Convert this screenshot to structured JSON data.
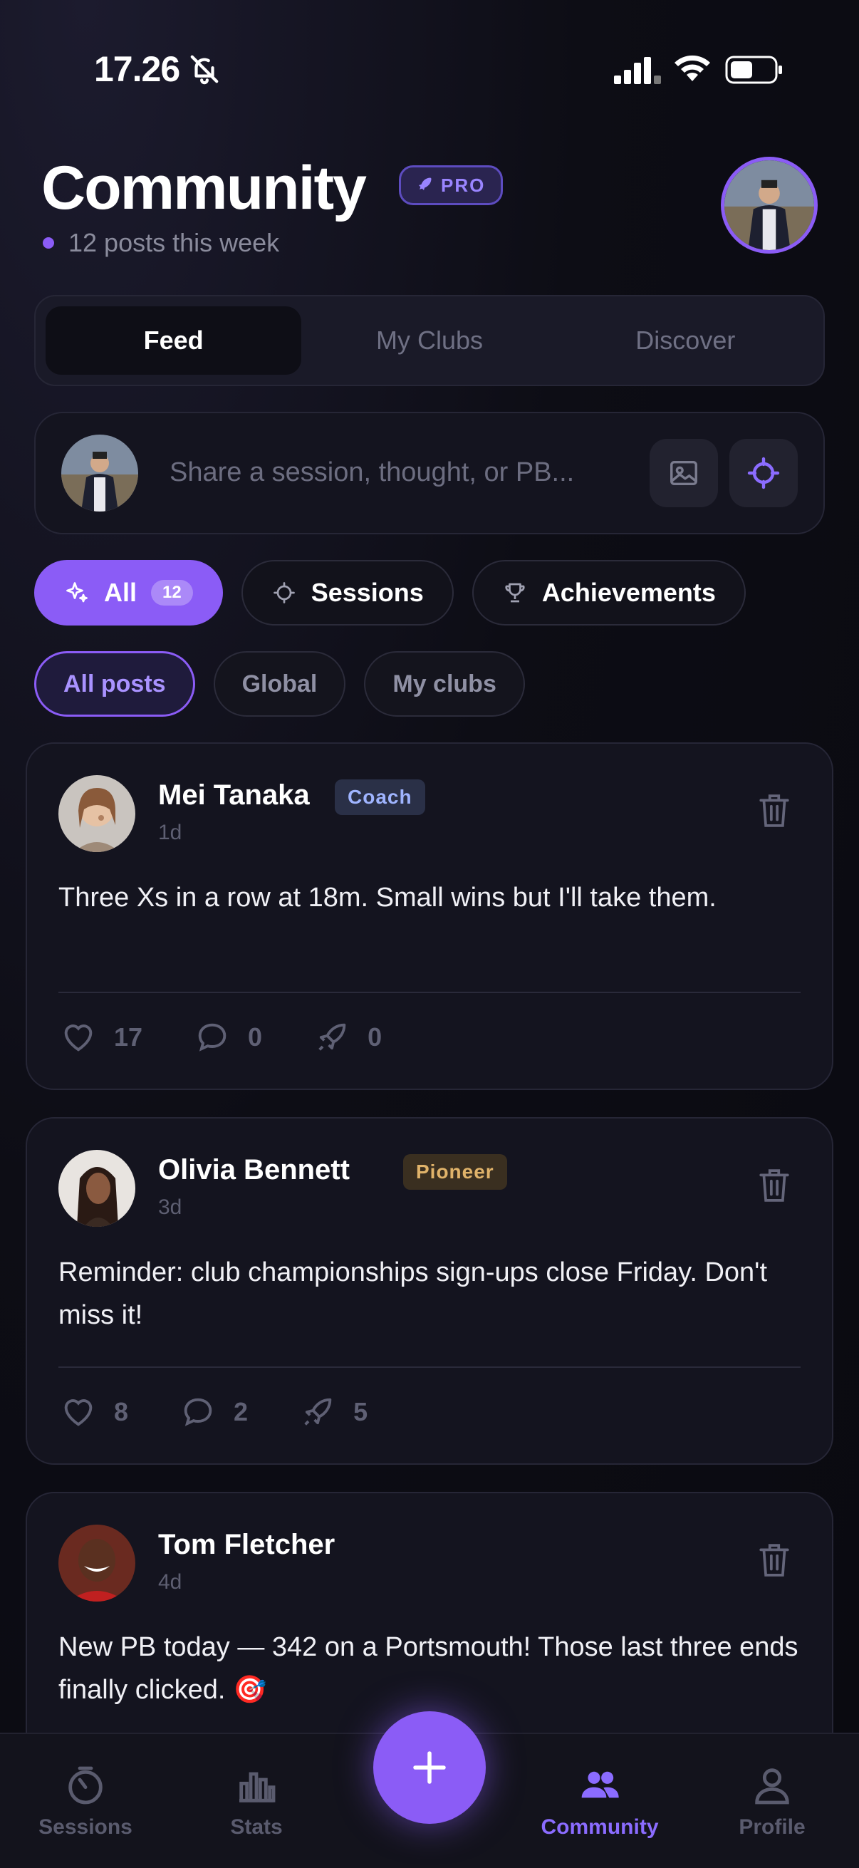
{
  "status_bar": {
    "time": "17.26"
  },
  "header": {
    "title": "Community",
    "badge": "PRO",
    "subtitle": "12 posts this week"
  },
  "segments": [
    {
      "label": "Feed",
      "active": true
    },
    {
      "label": "My Clubs",
      "active": false
    },
    {
      "label": "Discover",
      "active": false
    }
  ],
  "composer": {
    "placeholder": "Share a session, thought, or PB..."
  },
  "filters": [
    {
      "label": "All",
      "count": "12",
      "icon": "sparkles-icon",
      "active": true
    },
    {
      "label": "Sessions",
      "icon": "crosshair-icon",
      "active": false
    },
    {
      "label": "Achievements",
      "icon": "trophy-icon",
      "active": false
    }
  ],
  "scope": [
    {
      "label": "All posts",
      "active": true
    },
    {
      "label": "Global",
      "active": false
    },
    {
      "label": "My clubs",
      "active": false
    }
  ],
  "posts": [
    {
      "name": "Mei Tanaka",
      "role": "Coach",
      "time": "1d",
      "body": "Three Xs in a row at 18m. Small wins but I'll take them.",
      "likes": "17",
      "comments": "0",
      "boosts": "0"
    },
    {
      "name": "Olivia Bennett",
      "role": "Pioneer",
      "time": "3d",
      "body": "Reminder: club championships sign-ups close Friday. Don't miss it!",
      "likes": "8",
      "comments": "2",
      "boosts": "5"
    },
    {
      "name": "Tom Fletcher",
      "role": "",
      "time": "4d",
      "body": "New PB today — 342 on a Portsmouth! Those last three ends finally clicked. 🎯"
    }
  ],
  "tabbar": {
    "sessions": "Sessions",
    "stats": "Stats",
    "community": "Community",
    "profile": "Profile"
  },
  "colors": {
    "accent": "#8b5cf6",
    "coach": "#9fb4ff",
    "pioneer": "#e0b36a"
  }
}
